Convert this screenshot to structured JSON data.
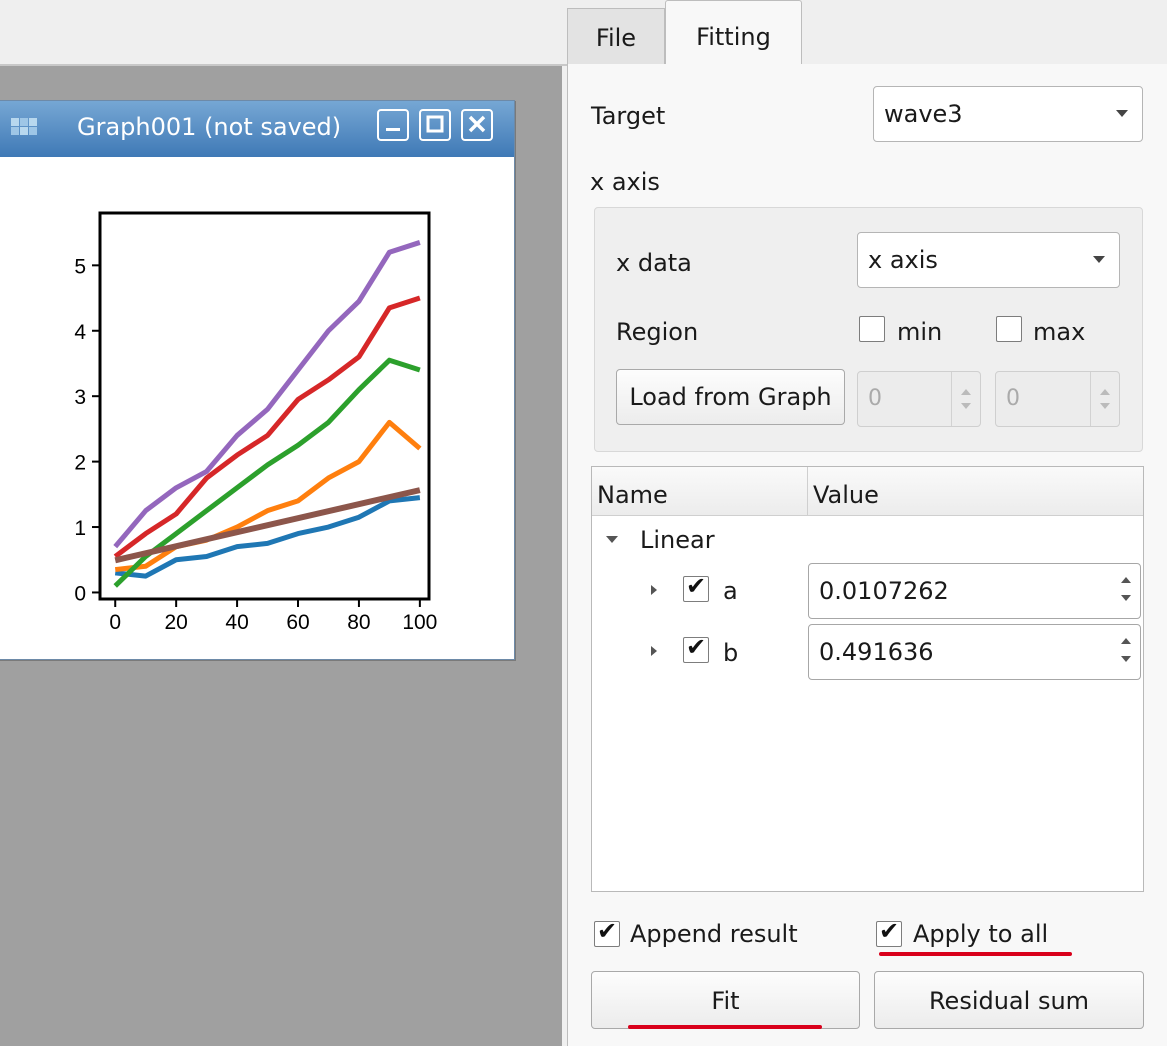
{
  "tabs": [
    {
      "label": "File"
    },
    {
      "label": "Fitting"
    }
  ],
  "graph_window": {
    "title": "Graph001 (not saved)"
  },
  "chart_data": {
    "type": "line",
    "xlim": [
      -5,
      103
    ],
    "ylim": [
      -0.1,
      5.8
    ],
    "xticks": [
      0,
      20,
      40,
      60,
      80,
      100
    ],
    "yticks": [
      0,
      1,
      2,
      3,
      4,
      5
    ],
    "grid": false,
    "series": [
      {
        "color": "#1f77b4",
        "x": [
          0,
          10,
          20,
          30,
          40,
          50,
          60,
          70,
          80,
          90,
          100
        ],
        "values": [
          0.3,
          0.25,
          0.5,
          0.55,
          0.7,
          0.75,
          0.9,
          1.0,
          1.15,
          1.4,
          1.45
        ]
      },
      {
        "color": "#ff7f0e",
        "x": [
          0,
          10,
          20,
          30,
          40,
          50,
          60,
          70,
          80,
          90,
          100
        ],
        "values": [
          0.35,
          0.4,
          0.7,
          0.8,
          1.0,
          1.25,
          1.4,
          1.75,
          2.0,
          2.6,
          2.2
        ]
      },
      {
        "color": "#2ca02c",
        "x": [
          0,
          10,
          20,
          30,
          40,
          50,
          60,
          70,
          80,
          90,
          100
        ],
        "values": [
          0.1,
          0.55,
          0.9,
          1.25,
          1.6,
          1.95,
          2.25,
          2.6,
          3.1,
          3.55,
          3.4
        ]
      },
      {
        "color": "#d62728",
        "x": [
          0,
          10,
          20,
          30,
          40,
          50,
          60,
          70,
          80,
          90,
          100
        ],
        "values": [
          0.55,
          0.9,
          1.2,
          1.75,
          2.1,
          2.4,
          2.95,
          3.25,
          3.6,
          4.35,
          4.5
        ]
      },
      {
        "color": "#9467bd",
        "x": [
          0,
          10,
          20,
          30,
          40,
          50,
          60,
          70,
          80,
          90,
          100
        ],
        "values": [
          0.7,
          1.25,
          1.6,
          1.85,
          2.4,
          2.8,
          3.4,
          4.0,
          4.45,
          5.2,
          5.35
        ]
      },
      {
        "color": "#8c564b",
        "x": [
          0,
          100
        ],
        "values": [
          0.4916,
          1.5643
        ]
      }
    ]
  },
  "fitting": {
    "target_label": "Target",
    "target_value": "wave3",
    "xaxis_section": "x axis",
    "xdata_label": "x data",
    "xdata_value": "x axis",
    "region_label": "Region",
    "min_label": "min",
    "max_label": "max",
    "load_button": "Load from Graph",
    "min_value": "0",
    "max_value": "0",
    "table": {
      "col_name": "Name",
      "col_value": "Value",
      "group": "Linear",
      "params": [
        {
          "name": "a",
          "value": "0.0107262",
          "checked": true
        },
        {
          "name": "b",
          "value": "0.491636",
          "checked": true
        }
      ]
    },
    "append_result": "Append result",
    "apply_to_all": "Apply to all",
    "fit_button": "Fit",
    "residual_button": "Residual sum"
  },
  "colors": {
    "highlight": "#d9001b",
    "titlebar": "#3f79b6"
  }
}
